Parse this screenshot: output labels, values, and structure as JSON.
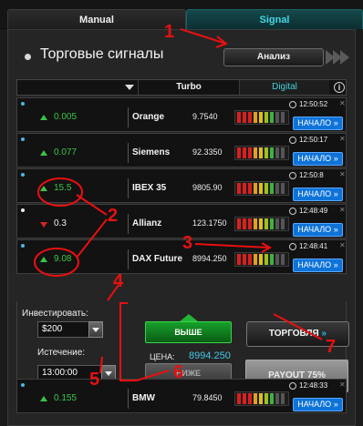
{
  "tabs": {
    "manual": "Manual",
    "signal": "Signal"
  },
  "header": {
    "title": "Торговые сигналы",
    "analysis_button": "Анализ"
  },
  "table_header": {
    "turbo": "Turbo",
    "digital": "Digital",
    "info_icon": "i"
  },
  "signals": [
    {
      "change": "0.005",
      "direction": "up",
      "asset": "Orange",
      "price": "9.7540",
      "time": "12:50:52",
      "button": "НАЧАЛО"
    },
    {
      "change": "0.077",
      "direction": "up",
      "asset": "Siemens",
      "price": "92.3350",
      "time": "12:50:17",
      "button": "НАЧАЛО"
    },
    {
      "change": "15.5",
      "direction": "up",
      "asset": "IBEX 35",
      "price": "9805.90",
      "time": "12:50:8",
      "button": "НАЧАЛО"
    },
    {
      "change": "0.3",
      "direction": "down",
      "asset": "Allianz",
      "price": "123.1750",
      "time": "12:48:49",
      "button": "НАЧАЛО"
    },
    {
      "change": "9.08",
      "direction": "up",
      "asset": "DAX Future",
      "price": "8994.250",
      "time": "12:48:41",
      "button": "НАЧАЛО"
    },
    {
      "change": "0.155",
      "direction": "up",
      "asset": "BMW",
      "price": "79.8450",
      "time": "12:48:33",
      "button": "НАЧАЛО"
    }
  ],
  "trade": {
    "invest_label": "Инвестировать:",
    "invest_value": "$200",
    "expiry_label": "Истечение:",
    "expiry_value": "13:00:00",
    "up_button": "ВЫШЕ",
    "price_label": "ЦЕНА:",
    "price_value": "8994.250",
    "down_button": "НИЖЕ",
    "trade_button": "ТОРГОВЛЯ",
    "payout": "PAYOUT 75%"
  },
  "annotations": [
    "1",
    "2",
    "3",
    "4",
    "5",
    "6",
    "7"
  ],
  "colors": {
    "accent_cyan": "#42d0e0",
    "up_green": "#3cc447",
    "down_red": "#dd2222",
    "start_blue": "#0e73d8",
    "annotation_red": "#e81010"
  }
}
